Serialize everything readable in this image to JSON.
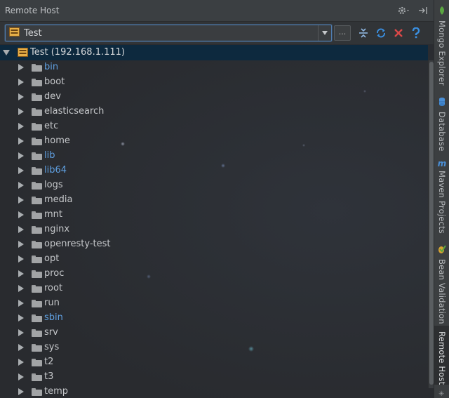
{
  "panel": {
    "title": "Remote Host",
    "host_select": {
      "value": "Test"
    },
    "more_button": "...",
    "root": {
      "label": "Test (192.168.1.111)"
    },
    "folders": [
      {
        "name": "bin",
        "link": true
      },
      {
        "name": "boot",
        "link": false
      },
      {
        "name": "dev",
        "link": false
      },
      {
        "name": "elasticsearch",
        "link": false
      },
      {
        "name": "etc",
        "link": false
      },
      {
        "name": "home",
        "link": false
      },
      {
        "name": "lib",
        "link": true
      },
      {
        "name": "lib64",
        "link": true
      },
      {
        "name": "logs",
        "link": false
      },
      {
        "name": "media",
        "link": false
      },
      {
        "name": "mnt",
        "link": false
      },
      {
        "name": "nginx",
        "link": false
      },
      {
        "name": "openresty-test",
        "link": false
      },
      {
        "name": "opt",
        "link": false
      },
      {
        "name": "proc",
        "link": false
      },
      {
        "name": "root",
        "link": false
      },
      {
        "name": "run",
        "link": false
      },
      {
        "name": "sbin",
        "link": true
      },
      {
        "name": "srv",
        "link": false
      },
      {
        "name": "sys",
        "link": false
      },
      {
        "name": "t2",
        "link": false
      },
      {
        "name": "t3",
        "link": false
      },
      {
        "name": "temp",
        "link": false
      }
    ]
  },
  "side_tabs": [
    {
      "label": "Mongo Explorer",
      "icon": "leaf-icon",
      "active": false
    },
    {
      "label": "Database",
      "icon": "database-icon",
      "active": false
    },
    {
      "label": "Maven Projects",
      "icon": "maven-icon",
      "active": false
    },
    {
      "label": "Bean Validation",
      "icon": "bean-validation-icon",
      "active": false
    },
    {
      "label": "Remote Host",
      "icon": "",
      "active": true
    }
  ],
  "colors": {
    "link": "#5f9fe0",
    "selection": "#0d293e",
    "close_red": "#d84848",
    "help_blue": "#3a8fe0",
    "sync_blue": "#3a8fe0"
  }
}
